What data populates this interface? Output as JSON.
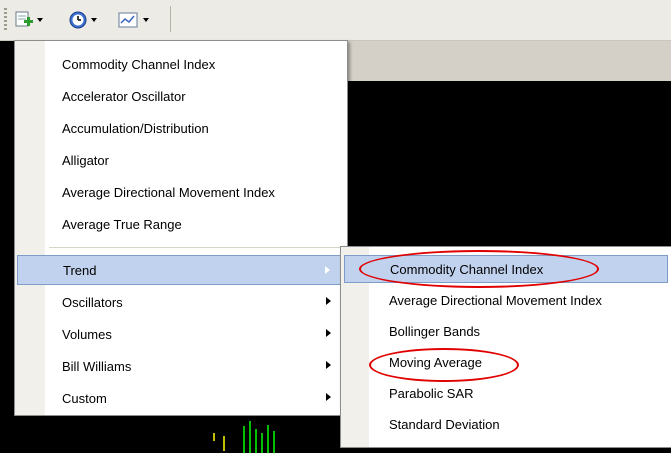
{
  "toolbar": {
    "buttons": [
      {
        "icon": "indicators-add-icon"
      },
      {
        "icon": "periodicity-clock-icon"
      },
      {
        "icon": "templates-chart-icon"
      }
    ]
  },
  "menu": {
    "items": [
      {
        "label": "Commodity Channel Index"
      },
      {
        "label": "Accelerator Oscillator"
      },
      {
        "label": "Accumulation/Distribution"
      },
      {
        "label": "Alligator"
      },
      {
        "label": "Average Directional Movement Index"
      },
      {
        "label": "Average True Range"
      }
    ],
    "categories": [
      {
        "label": "Trend",
        "highlighted": true
      },
      {
        "label": "Oscillators"
      },
      {
        "label": "Volumes"
      },
      {
        "label": "Bill Williams"
      },
      {
        "label": "Custom"
      }
    ]
  },
  "submenu": {
    "items": [
      {
        "label": "Commodity Channel Index",
        "highlighted": true,
        "circled": true
      },
      {
        "label": "Average Directional Movement Index"
      },
      {
        "label": "Bollinger Bands"
      },
      {
        "label": "Moving Average",
        "circled": true
      },
      {
        "label": "Parabolic SAR"
      },
      {
        "label": "Standard Deviation"
      }
    ]
  },
  "colors": {
    "highlight": "#c1d2ee",
    "annotation": "#e00000",
    "chart_background": "#000000"
  }
}
